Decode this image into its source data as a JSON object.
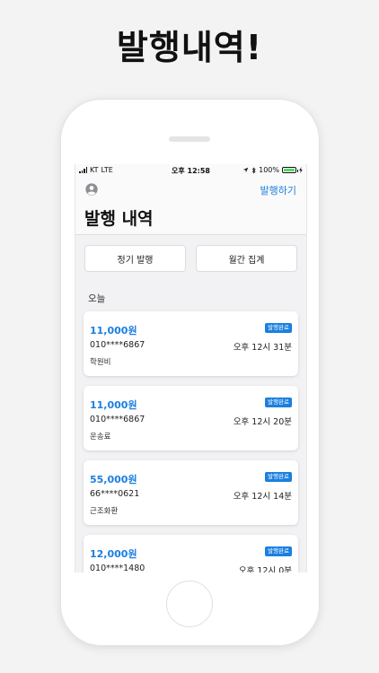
{
  "promo": {
    "title": "발행내역!"
  },
  "status_bar": {
    "carrier": "KT",
    "network": "LTE",
    "time": "오후 12:58",
    "battery": "100%"
  },
  "nav": {
    "issue_label": "발행하기",
    "title": "발행 내역"
  },
  "segments": {
    "regular": "정기 발행",
    "monthly": "월간 집계"
  },
  "section": {
    "today": "오늘"
  },
  "receipts": [
    {
      "amount": "11,000원",
      "badge": "발행완료",
      "phone": "010****6867",
      "time": "오후 12시 31분",
      "memo": "학원비"
    },
    {
      "amount": "11,000원",
      "badge": "발행완료",
      "phone": "010****6867",
      "time": "오후 12시 20분",
      "memo": "운송료"
    },
    {
      "amount": "55,000원",
      "badge": "발행완료",
      "phone": "66****0621",
      "time": "오후 12시 14분",
      "memo": "근조화환"
    },
    {
      "amount": "12,000원",
      "badge": "발행완료",
      "phone": "010****1480",
      "time": "오후 12시 0분",
      "memo": ""
    }
  ],
  "colors": {
    "accent": "#1b7fe0",
    "background": "#f3f3f4",
    "battery": "#4cd964"
  },
  "icons": [
    "profile-icon",
    "location-arrow-icon",
    "bluetooth-icon",
    "battery-icon",
    "signal-icon"
  ]
}
